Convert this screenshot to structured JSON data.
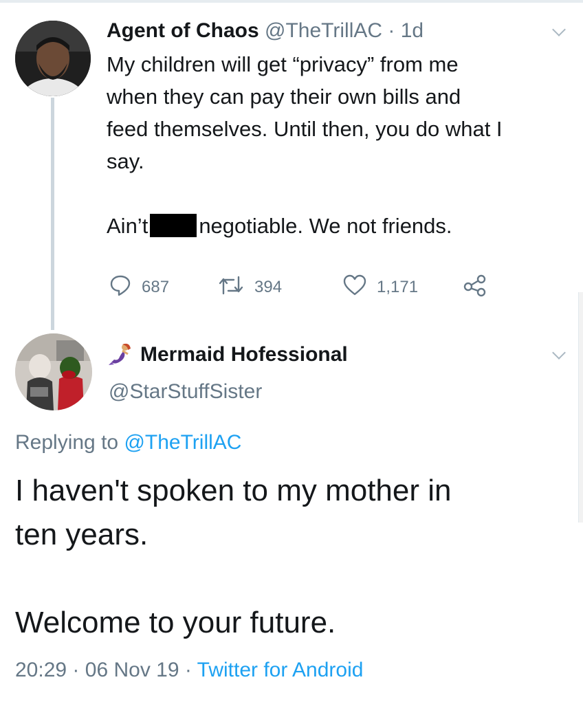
{
  "tweet1": {
    "name": "Agent of Chaos",
    "handle": "@TheTrillAC",
    "separator": "·",
    "time": "1d",
    "lines": [
      "My children will get “privacy” from me",
      "when they can pay their own bills and",
      "feed themselves. Until then, you do what I",
      "say."
    ],
    "second_para_before": "Ain’t",
    "second_para_after": "negotiable. We not friends.",
    "actions": {
      "replies": "687",
      "retweets": "394",
      "likes": "1,171"
    }
  },
  "tweet2": {
    "name": "Mermaid Hofessional",
    "handle": "@StarStuffSister",
    "replying_prefix": "Replying to",
    "replying_to": "@TheTrillAC",
    "para1_line1": "I haven't spoken to my mother in",
    "para1_line2": "ten years.",
    "para2": "Welcome to your future.",
    "time": "20:29",
    "date": "06 Nov 19",
    "source": "Twitter for Android",
    "meta_sep": "·"
  },
  "colors": {
    "text": "#14171a",
    "secondary": "#657786",
    "link": "#1da1f2",
    "thread_line": "#ccd6dd"
  },
  "icons": [
    "reply-icon",
    "retweet-icon",
    "like-icon",
    "share-icon",
    "chevron-down-icon",
    "mermaid-emoji"
  ]
}
